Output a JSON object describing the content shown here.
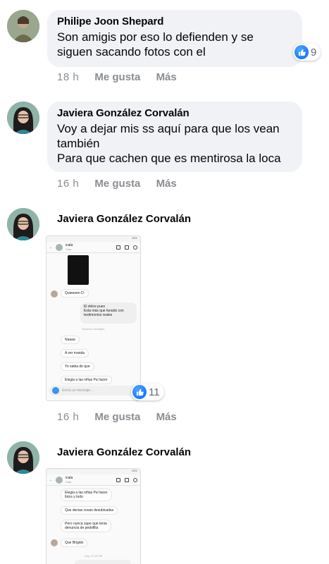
{
  "comments": [
    {
      "author": "Philipe Joon Shepard",
      "text": [
        "Son amigis por eso lo defienden y se",
        "siguen sacando fotos con el"
      ],
      "time": "18 h",
      "like_label": "Me gusta",
      "more_label": "Más",
      "reactions": "9"
    },
    {
      "author": "Javiera González Corvalán",
      "text": [
        "Voy a dejar mis ss aquí para que los vean",
        "también",
        "Para que cachen que es mentirosa la loca"
      ],
      "time": "16 h",
      "like_label": "Me gusta",
      "more_label": "Más"
    },
    {
      "author": "Javiera González Corvalán",
      "time": "16 h",
      "like_label": "Me gusta",
      "more_label": "Más",
      "reactions": "11",
      "screenshot": {
        "status": "28%",
        "chat_name": "icala",
        "chat_sub": "Cala",
        "messages": [
          "Quieeeen D:",
          "El dolce pues",
          "Esta más que funado con",
          "testimonios reales",
          "Nuevos mensajes",
          "Naaaa",
          "A ver manda",
          "Yo sabia de que",
          "Elegia a las niñas Pa hacer"
        ],
        "input_placeholder": "Envía un mensaje..."
      }
    },
    {
      "author": "Javiera González Corvalán",
      "screenshot": {
        "status": "28%",
        "chat_name": "icala",
        "chat_sub": "Cala",
        "messages": [
          "Elegia a las niñas Pa hacer",
          "fotos y todo",
          "Que decias cosas desubicadas",
          "Pero nunca supe que tenia",
          "denuncia de pedofilia",
          "Que Brigido",
          "Hoy 17:19 PM"
        ]
      }
    }
  ],
  "colors": {
    "bubble": "#f0f2f5",
    "meta": "#8a8d91",
    "like": "#0866ff"
  }
}
